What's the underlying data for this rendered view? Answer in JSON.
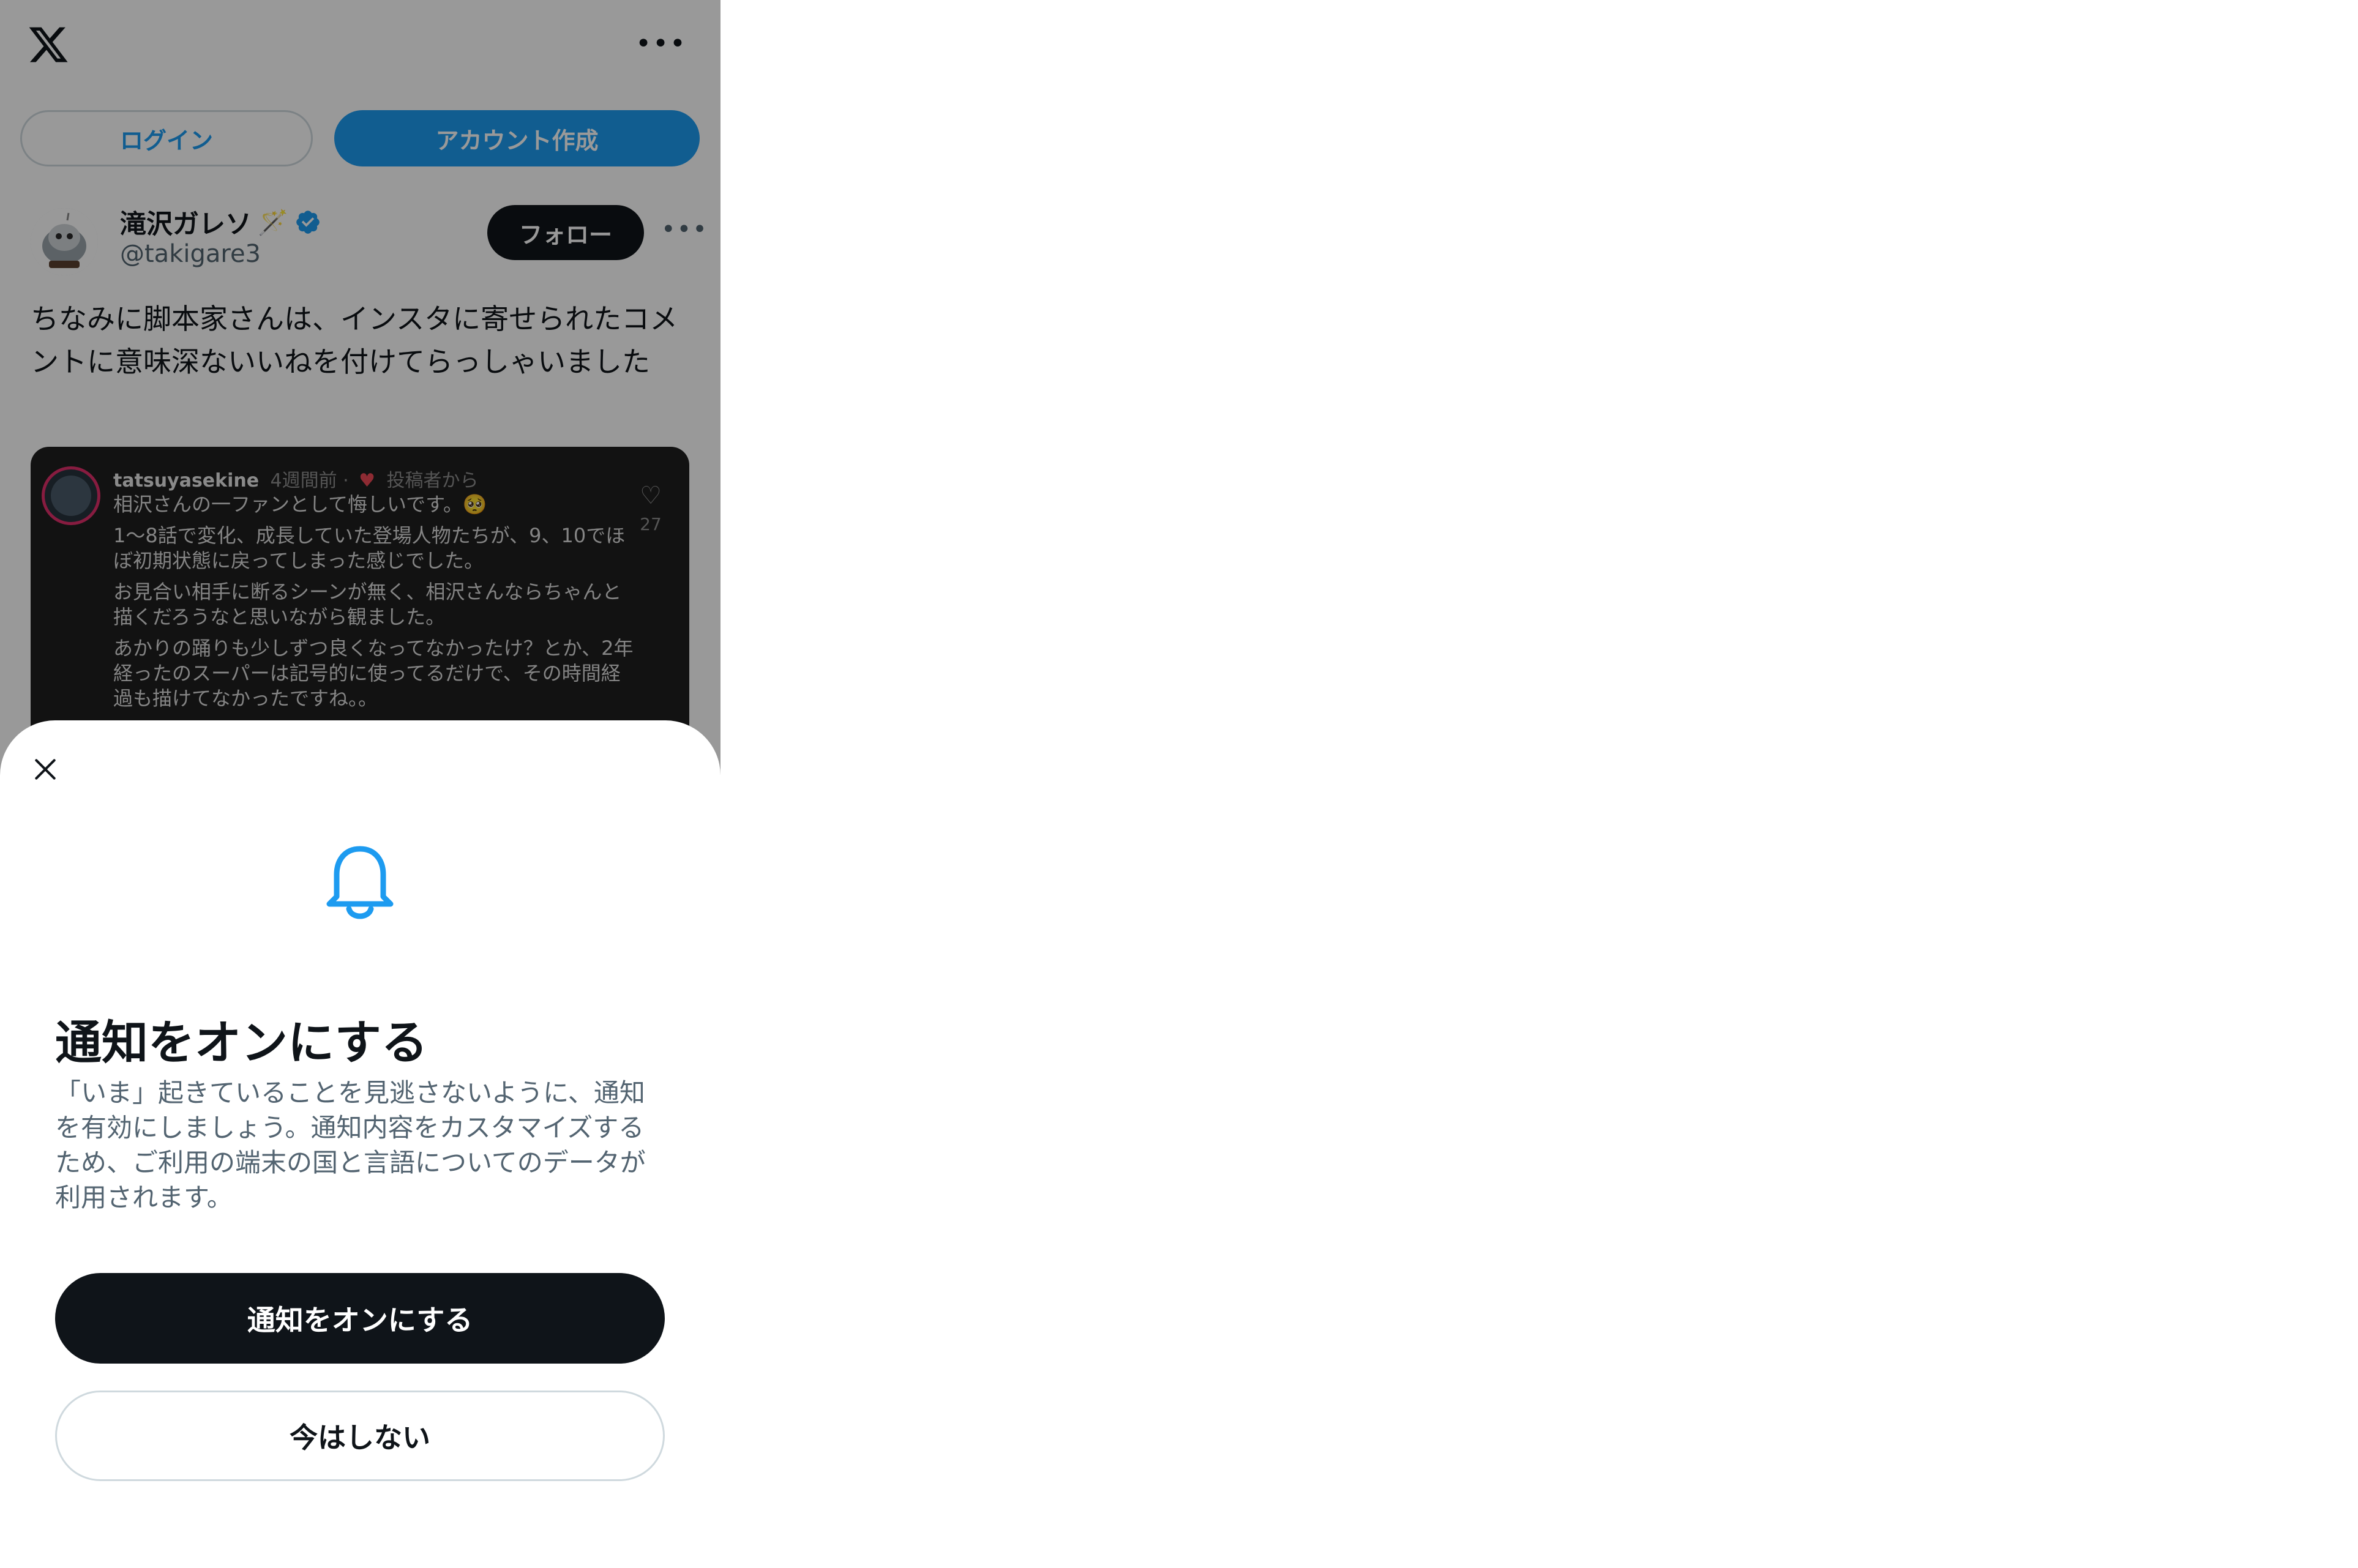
{
  "topbar": {
    "logo_icon": "x-logo-icon",
    "more_label": "•••"
  },
  "auth": {
    "login_label": "ログイン",
    "signup_label": "アカウント作成"
  },
  "tweet": {
    "display_name": "滝沢ガレソ",
    "name_emoji": "🪄",
    "handle": "@takigare3",
    "follow_label": "フォロー",
    "more_label": "•••",
    "text": "ちなみに脚本家さんは、インスタに寄せられたコメントに意味深ないいねを付けてらっしゃいました",
    "embed": {
      "username": "tatsuyasekine",
      "time": "4週間前 ·",
      "heart": "♥",
      "liked_by": "投稿者から",
      "lines": [
        "相沢さんの一ファンとして悔しいです。🥺",
        "1〜8話で変化、成長していた登場人物たちが、9、10でほぼ初期状態に戻ってしまった感じでした。",
        "お見合い相手に断るシーンが無く、相沢さんならちゃんと描くだろうなと思いながら観ました。",
        "あかりの踊りも少しずつ良くなってなかったけ？とか、2年経ったのスーパーは記号的に使ってるだけで、その時間経過も描けてなかったですね。。"
      ],
      "like_count": "27"
    }
  },
  "sheet": {
    "close_icon": "close-icon",
    "bell_icon": "bell-icon",
    "title": "通知をオンにする",
    "description": "「いま」起きていることを見逃さないように、通知を有効にしましょう。通知内容をカスタマイズするため、ご利用の端末の国と言語についてのデータが利用されます。",
    "enable_label": "通知をオンにする",
    "not_now_label": "今はしない"
  },
  "colors": {
    "accent": "#1d9bf0",
    "dark": "#0f1419",
    "muted": "#536471",
    "overlay": "rgba(0,0,0,0.4)"
  }
}
